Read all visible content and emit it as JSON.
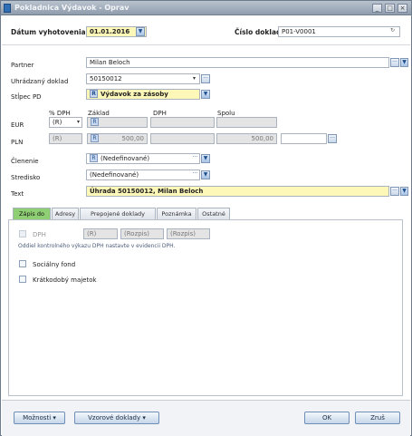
{
  "window": {
    "title": "Pokladnica Výdavok - Oprav",
    "buttons": [
      "_",
      "□",
      "×"
    ]
  },
  "header": {
    "date_label": "Dátum vyhotovenia",
    "date_value": "01.01.2016",
    "doc_number_label": "Číslo dokladu",
    "doc_number_value": "P01-V0001"
  },
  "form": {
    "partner_label": "Partner",
    "partner_value": "Milan Beloch",
    "paid_doc_label": "Uhrádzaný doklad",
    "paid_doc_value": "50150012",
    "pd_column_label": "Stĺpec PD",
    "pd_column_tag": "R",
    "pd_column_value": "Výdavok za zásoby"
  },
  "vat": {
    "col_pct": "% DPH",
    "col_base": "Základ",
    "col_vat": "DPH",
    "col_total": "Spolu",
    "row_eur_label": "EUR",
    "row_pln_label": "PLN",
    "eur_pct": "(R)",
    "pln_pct": "(R)",
    "tag": "R",
    "pln_base": "500,00",
    "pln_total": "500,00"
  },
  "classification": {
    "clenenie_label": "Členenie",
    "clenenie_tag": "R",
    "clenenie_value": "(Nedefinované)",
    "stredisko_label": "Stredisko",
    "stredisko_value": "(Nedefinované)",
    "text_label": "Text",
    "text_value": "Úhrada 50150012, Milan Beloch"
  },
  "tabs": [
    "Zápis do",
    "Adresy",
    "Prepojené doklady",
    "Poznámka",
    "Ostatné"
  ],
  "tab_content": {
    "dph_label": "DPH",
    "dph_sel1": "(R)",
    "dph_sel2": "(Rozpis)",
    "dph_sel3": "(Rozpis)",
    "kv_note": "Oddiel kontrolného výkazu DPH nastavte v evidencii DPH.",
    "social_fund_label": "Sociálny fond",
    "short_term_label": "Krátkodobý majetok"
  },
  "footer": {
    "options_label": "Možnosti",
    "sample_docs_label": "Vzorové doklady",
    "ok_label": "OK",
    "cancel_label": "Zruš"
  }
}
